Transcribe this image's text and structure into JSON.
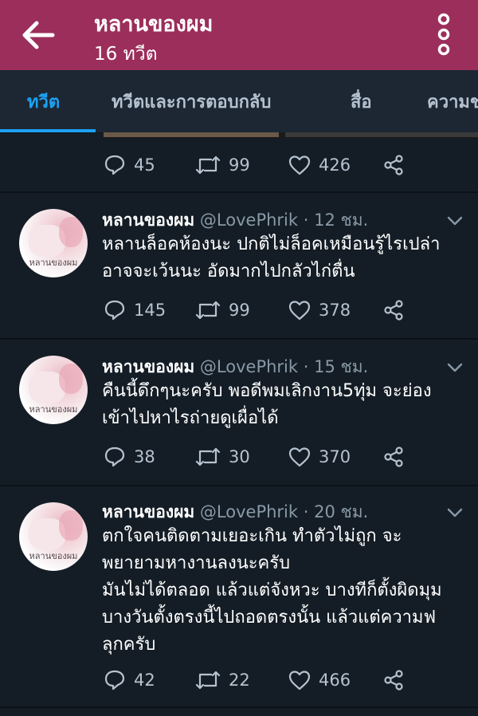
{
  "appbar": {
    "title": "หลานของผม",
    "subtitle": "16 ทวีต"
  },
  "tabs": [
    {
      "label": "ทวีต"
    },
    {
      "label": "ทวีตและการตอบกลับ"
    },
    {
      "label": "สื่อ"
    },
    {
      "label": "ความช"
    }
  ],
  "top_tweet": {
    "replies": "45",
    "retweets": "99",
    "likes": "426"
  },
  "tweets": [
    {
      "avatar_label": "หลานของผม",
      "name": "หลานของผม",
      "handle": "@LovePhrik",
      "time": "· 12 ชม.",
      "lines": [
        "หลานล็อคห้องนะ ปกติไม่ล็อคเหมือนรู้ไรเปล่า",
        "อาจจะเว้นนะ อัดมากไปกลัวไก่ตื่น"
      ],
      "replies": "145",
      "retweets": "99",
      "likes": "378"
    },
    {
      "avatar_label": "หลานของผม",
      "name": "หลานของผม",
      "handle": "@LovePhrik",
      "time": "· 15 ชม.",
      "lines": [
        "คืนนี้ดึกๆนะครับ พอดีพมเลิกงาน5ทุ่ม จะย่อง",
        "เข้าไปหาไรถ่ายดูเผื่อได้"
      ],
      "replies": "38",
      "retweets": "30",
      "likes": "370"
    },
    {
      "avatar_label": "หลานของผม",
      "name": "หลานของผม",
      "handle": "@LovePhrik",
      "time": "· 20 ชม.",
      "lines": [
        "ตกใจคนติดตามเยอะเกิน ทำตัวไม่ถูก จะ",
        "พยายามหางานลงนะครับ",
        "มันไม่ได้ตลอด แล้วแต่จังหวะ บางทีก็ตั้งผิดมุม",
        "บางวันตั้งตรงนี้ไปถอดตรงนั้น แล้วแต่ความฟ",
        "ลุกครับ"
      ],
      "replies": "42",
      "retweets": "22",
      "likes": "466"
    }
  ],
  "colors": {
    "appbar": "#9b2e5b",
    "background": "#141d26",
    "accent": "#1da1f2",
    "muted": "#8899a6"
  }
}
